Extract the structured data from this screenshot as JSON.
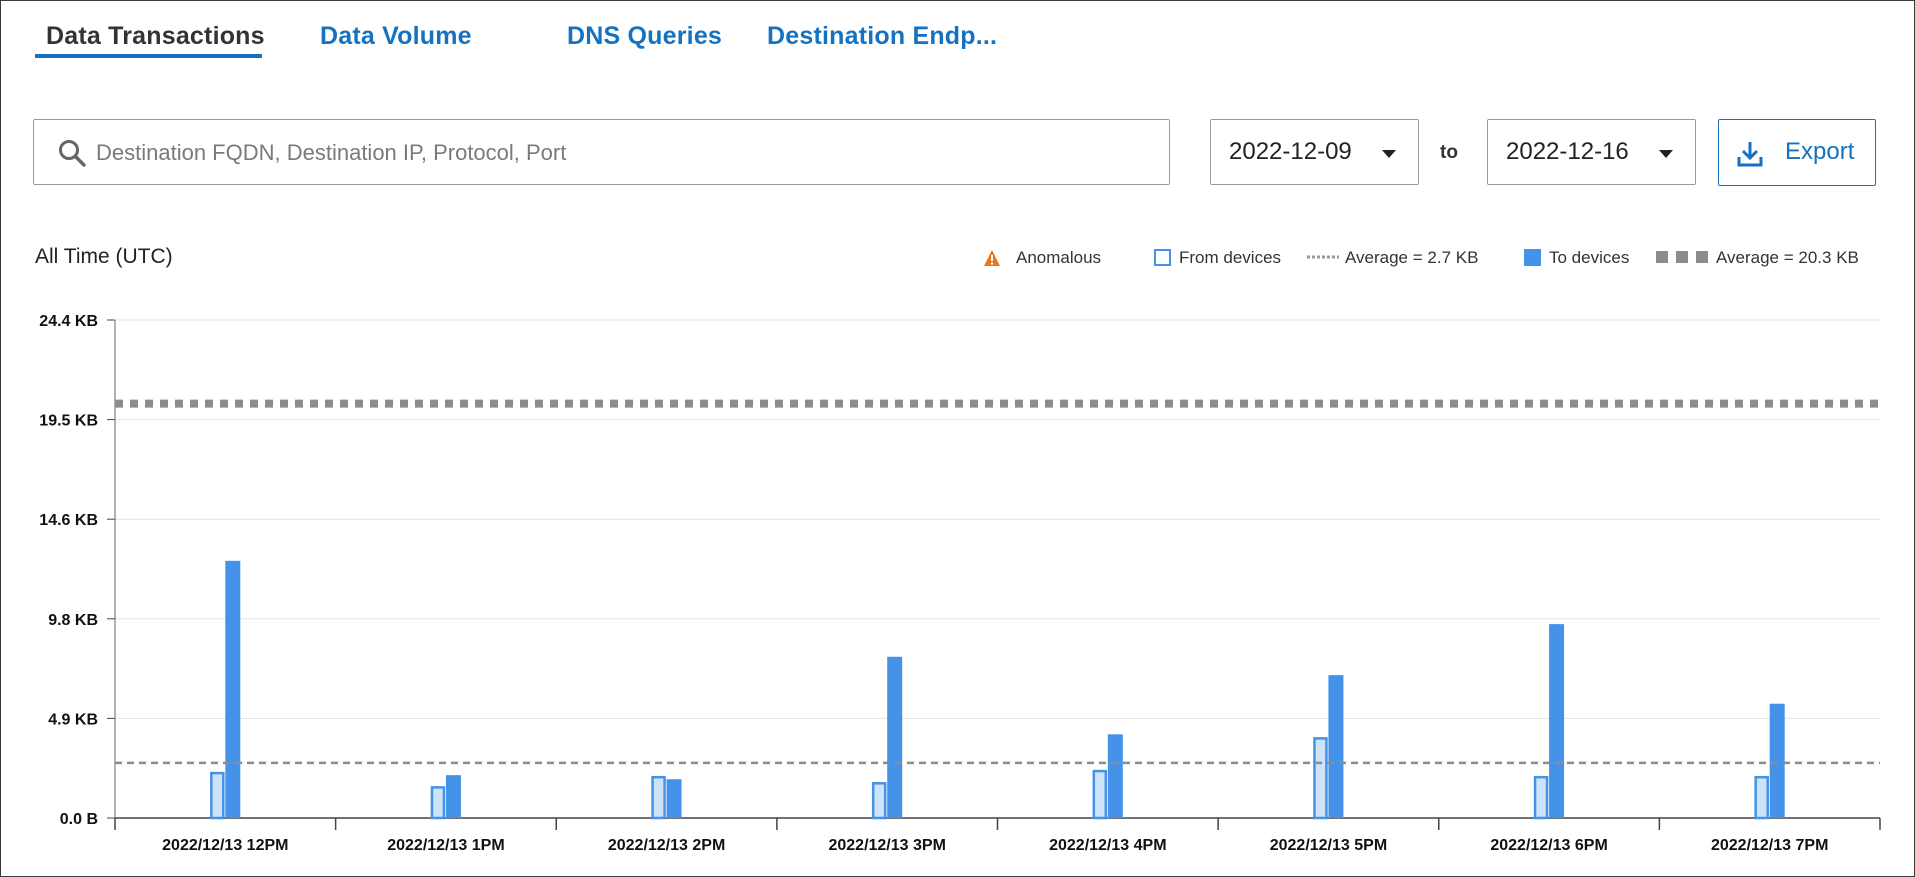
{
  "tabs": [
    {
      "label": "Data Transactions",
      "active": true
    },
    {
      "label": "Data Volume",
      "active": false
    },
    {
      "label": "DNS Queries",
      "active": false
    },
    {
      "label": "Destination Endp..."
    }
  ],
  "search": {
    "placeholder": "Destination FQDN, Destination IP, Protocol, Port",
    "value": ""
  },
  "date_range": {
    "from": "2022-12-09",
    "to_label": "to",
    "to": "2022-12-16"
  },
  "export": {
    "label": "Export"
  },
  "chart_header": {
    "time_range": "All Time (UTC)"
  },
  "legend": {
    "anomalous": "Anomalous",
    "from_devices": "From devices",
    "from_average": "Average = 2.7 KB",
    "to_devices": "To devices",
    "to_average": "Average = 20.3 KB"
  },
  "colors": {
    "accent": "#1672c0",
    "to_devices": "#4593e8",
    "from_devices_fill": "#cfe3f8",
    "from_devices_stroke": "#4593e8",
    "anomalous": "#e8761d",
    "average_line": "#8c8c8c"
  },
  "chart_data": {
    "type": "bar",
    "categories": [
      "2022/12/13 12PM",
      "2022/12/13 1PM",
      "2022/12/13 2PM",
      "2022/12/13 3PM",
      "2022/12/13 4PM",
      "2022/12/13 5PM",
      "2022/12/13 6PM",
      "2022/12/13 7PM"
    ],
    "series": [
      {
        "name": "From devices",
        "values": [
          2.2,
          1.5,
          2.0,
          1.7,
          2.3,
          3.9,
          2.0,
          2.0
        ]
      },
      {
        "name": "To devices",
        "values": [
          12.6,
          2.1,
          1.9,
          7.9,
          4.1,
          7.0,
          9.5,
          5.6
        ]
      }
    ],
    "averages": [
      {
        "name": "Average = 2.7 KB",
        "value": 2.7
      },
      {
        "name": "Average = 20.3 KB",
        "value": 20.3
      }
    ],
    "y_ticks": [
      "0.0 B",
      "4.9 KB",
      "9.8 KB",
      "14.6 KB",
      "19.5 KB",
      "24.4 KB"
    ],
    "ylim": [
      0,
      24.4
    ],
    "unit": "KB",
    "grid": true,
    "legend_position": "top-right"
  }
}
